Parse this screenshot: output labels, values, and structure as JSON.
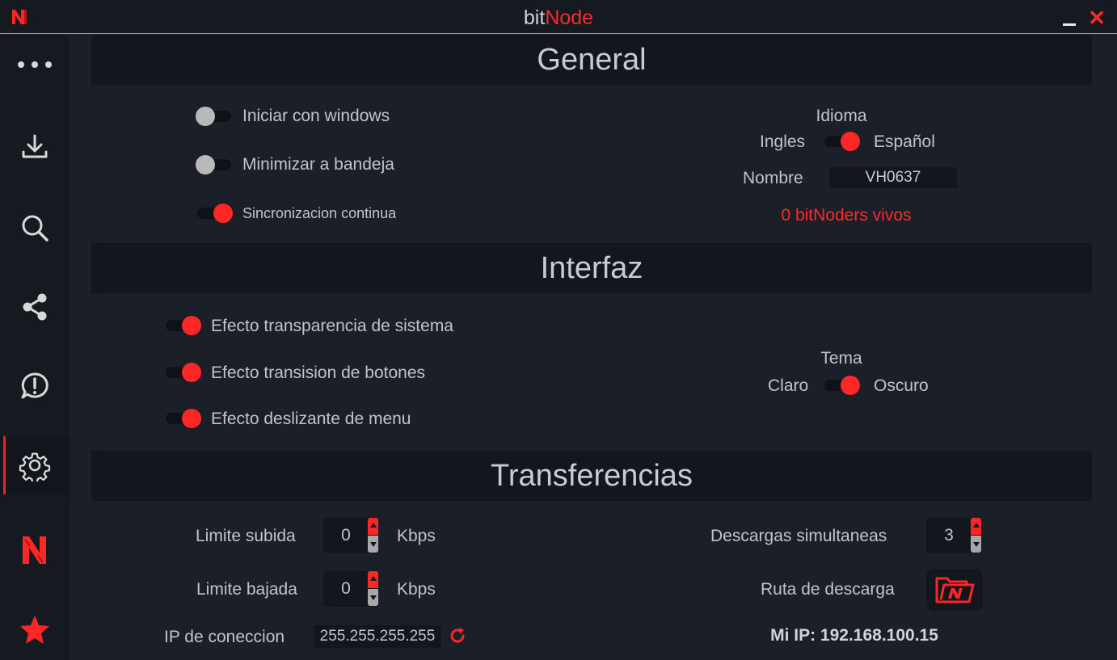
{
  "window": {
    "title_part1": "bit",
    "title_part2": "Node",
    "accent": "#ff2626"
  },
  "sidebar": {
    "items": [
      {
        "icon": "more-dots-icon"
      },
      {
        "icon": "download-icon"
      },
      {
        "icon": "search-icon"
      },
      {
        "icon": "share-icon"
      },
      {
        "icon": "alert-icon"
      },
      {
        "icon": "gear-icon",
        "active": true
      },
      {
        "icon": "bitnode-logo-icon"
      },
      {
        "icon": "star-icon"
      }
    ]
  },
  "general": {
    "header": "General",
    "start_with_windows": {
      "label": "Iniciar con windows",
      "on": false
    },
    "minimize_to_tray": {
      "label": "Minimizar a bandeja",
      "on": false
    },
    "continuous_sync": {
      "label": "Sincronizacion continua",
      "on": true
    },
    "language": {
      "title": "Idioma",
      "left": "Ingles",
      "right": "Español",
      "on": true
    },
    "name_label": "Nombre",
    "name_value": "VH0637",
    "alive": "0 bitNoders vivos"
  },
  "interface": {
    "header": "Interfaz",
    "transparency": {
      "label": "Efecto transparencia de sistema",
      "on": true
    },
    "button_transition": {
      "label": "Efecto transision de botones",
      "on": true
    },
    "menu_slide": {
      "label": "Efecto deslizante de menu",
      "on": true
    },
    "theme": {
      "title": "Tema",
      "left": "Claro",
      "right": "Oscuro",
      "on": true
    }
  },
  "transfers": {
    "header": "Transferencias",
    "upload_label": "Limite subida",
    "upload_value": "0",
    "download_label": "Limite bajada",
    "download_value": "0",
    "unit": "Kbps",
    "simultaneous_label": "Descargas simultaneas",
    "simultaneous_value": "3",
    "path_label": "Ruta de descarga",
    "ip_label": "IP de coneccion",
    "ip_value": "255.255.255.255",
    "my_ip": "Mi IP: 192.168.100.15"
  }
}
